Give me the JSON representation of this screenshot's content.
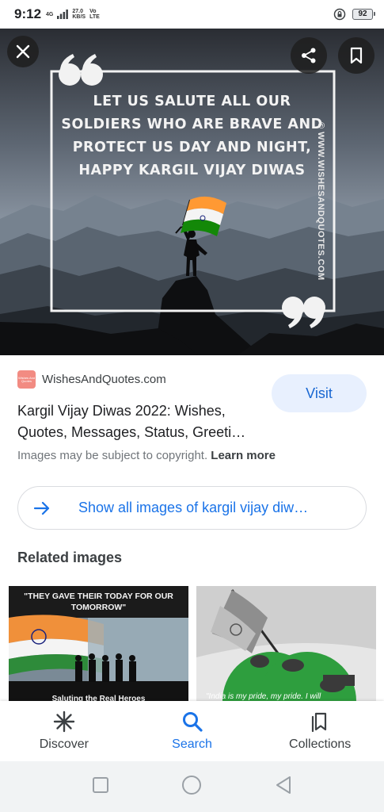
{
  "status": {
    "time": "9:12",
    "net_type": "4G",
    "speed": "27.0",
    "speed_unit": "KB/S",
    "volte_top": "Vo",
    "volte_bottom": "LTE",
    "battery": "92"
  },
  "hero": {
    "quote_lines": [
      "LET US SALUTE ALL OUR",
      "SOLDIERS WHO ARE BRAVE AND",
      "PROTECT US DAY AND NIGHT,",
      "HAPPY KARGIL VIJAY DIWAS"
    ],
    "watermark": "© WWW.WISHESANDQUOTES.COM",
    "close_icon": "close-icon",
    "share_icon": "share-icon",
    "bookmark_icon": "bookmark-icon"
  },
  "result": {
    "source_name": "WishesAndQuotes.com",
    "favicon_text": "Wishes And Quotes",
    "visit_label": "Visit",
    "title": "Kargil Vijay Diwas 2022: Wishes, Quotes, Messages, Status, Greeti…",
    "copyright_text": "Images may be subject to copyright.",
    "learn_more": "Learn more",
    "show_all_label": "Show all images of kargil vijay diw…"
  },
  "related": {
    "heading": "Related images",
    "thumbs": [
      {
        "caption_lines": [
          "\"THEY GAVE THEIR TODAY FOR OUR",
          "TOMORROW\""
        ],
        "bottom_text": "Saluting the Real Heroes"
      },
      {
        "bottom_text": "\"India is my pride, my pride. I will"
      }
    ]
  },
  "nav": {
    "items": [
      {
        "label": "Discover",
        "icon": "asterisk-icon"
      },
      {
        "label": "Search",
        "icon": "search-icon"
      },
      {
        "label": "Collections",
        "icon": "collections-icon"
      }
    ],
    "active": "Search"
  },
  "colors": {
    "accent": "#1a73e8",
    "visit_bg": "#e8f0fe",
    "saffron": "#ff9933",
    "green": "#138808"
  }
}
